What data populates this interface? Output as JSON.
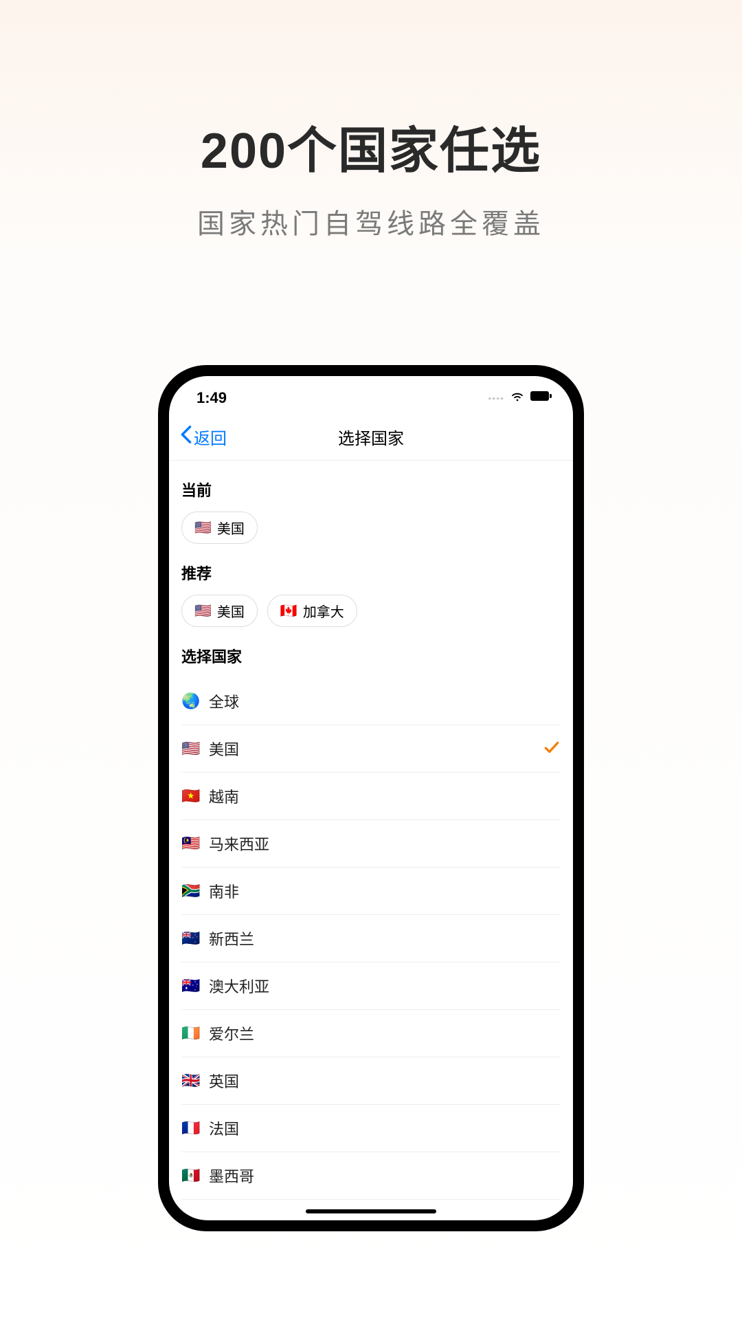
{
  "hero": {
    "title": "200个国家任选",
    "subtitle": "国家热门自驾线路全覆盖"
  },
  "status": {
    "time": "1:49"
  },
  "nav": {
    "back_label": "返回",
    "title": "选择国家"
  },
  "sections": {
    "current_label": "当前",
    "recommend_label": "推荐",
    "select_label": "选择国家"
  },
  "current": {
    "flag": "🇺🇸",
    "name": "美国"
  },
  "recommend": [
    {
      "flag": "🇺🇸",
      "name": "美国"
    },
    {
      "flag": "🇨🇦",
      "name": "加拿大"
    }
  ],
  "countries": [
    {
      "flag": "🌏",
      "name": "全球",
      "selected": false
    },
    {
      "flag": "🇺🇸",
      "name": "美国",
      "selected": true
    },
    {
      "flag": "🇻🇳",
      "name": "越南",
      "selected": false
    },
    {
      "flag": "🇲🇾",
      "name": "马来西亚",
      "selected": false
    },
    {
      "flag": "🇿🇦",
      "name": "南非",
      "selected": false
    },
    {
      "flag": "🇳🇿",
      "name": "新西兰",
      "selected": false
    },
    {
      "flag": "🇦🇺",
      "name": "澳大利亚",
      "selected": false
    },
    {
      "flag": "🇮🇪",
      "name": "爱尔兰",
      "selected": false
    },
    {
      "flag": "🇬🇧",
      "name": "英国",
      "selected": false
    },
    {
      "flag": "🇫🇷",
      "name": "法国",
      "selected": false
    },
    {
      "flag": "🇲🇽",
      "name": "墨西哥",
      "selected": false
    }
  ]
}
